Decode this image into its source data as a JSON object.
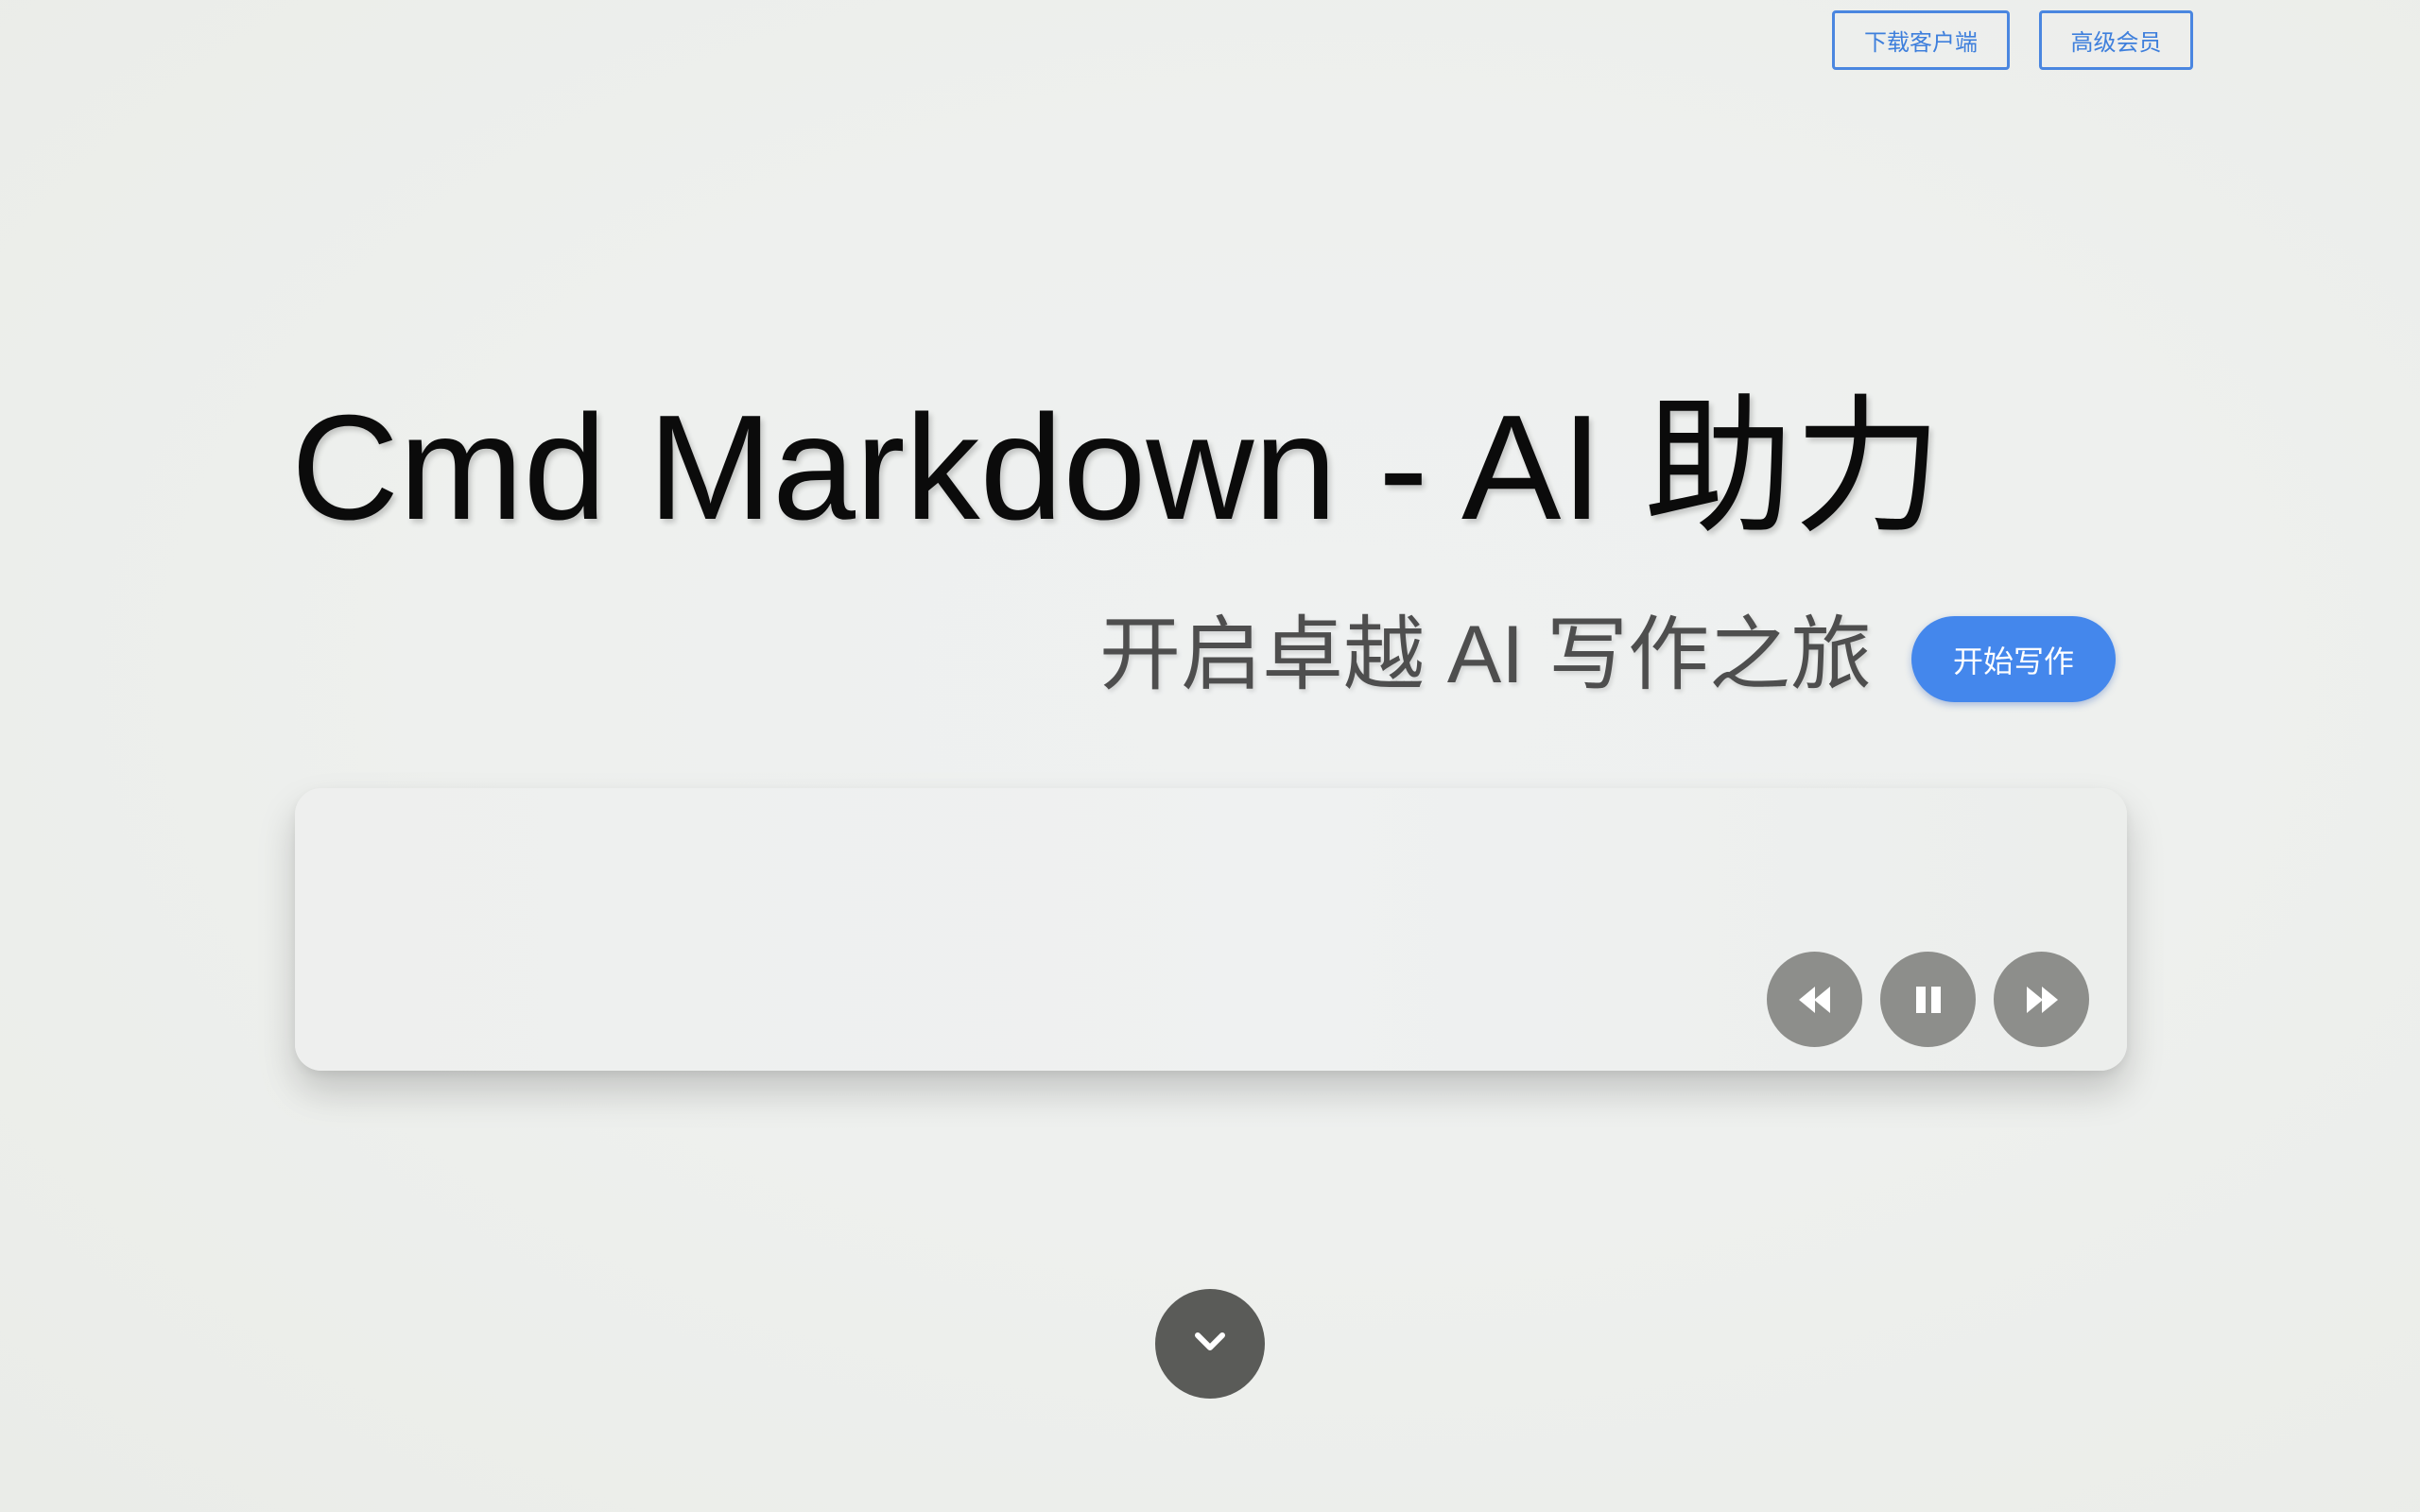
{
  "header": {
    "download_label": "下载客户端",
    "vip_label": "高级会员"
  },
  "hero": {
    "title": "Cmd Markdown - AI 助力",
    "subtitle": "开启卓越 AI 写作之旅",
    "start_label": "开始写作"
  },
  "player": {
    "controls": [
      "rewind-icon",
      "pause-icon",
      "fast-forward-icon"
    ]
  },
  "scroll": {
    "icon": "chevron-down-icon"
  },
  "colors": {
    "accent": "#4487ec",
    "outline_button": "#4a86e0",
    "control_bg": "#8d8e8b",
    "scroll_bg": "#5a5b58"
  }
}
